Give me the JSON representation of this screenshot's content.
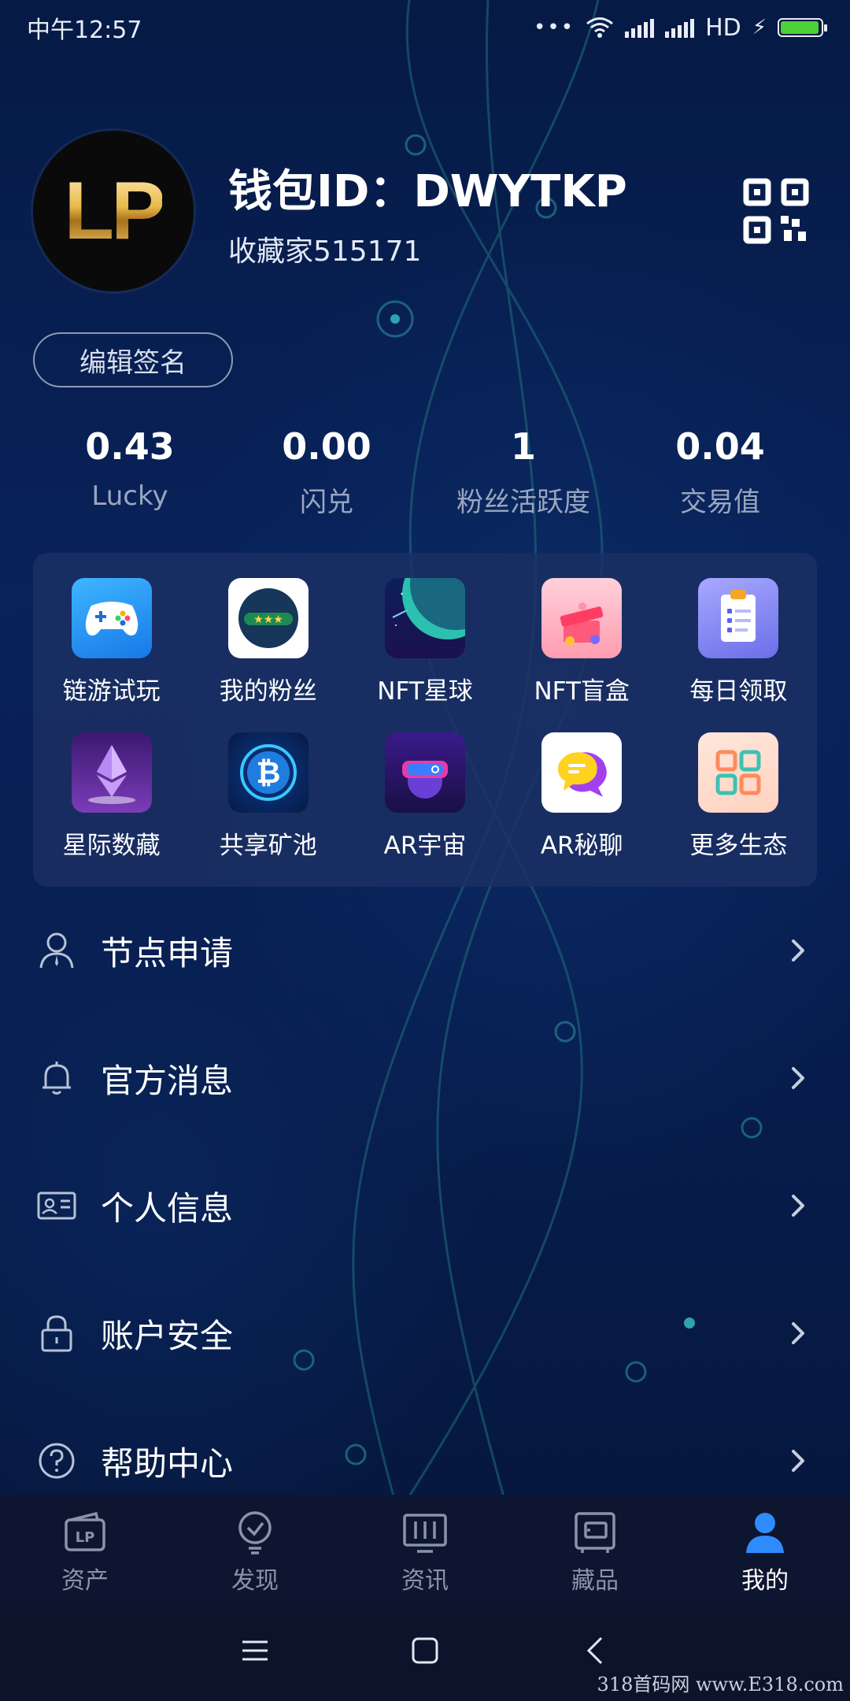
{
  "status_bar": {
    "time": "中午12:57",
    "dots": "•••",
    "network": "HD",
    "battery_level": 0.95
  },
  "profile": {
    "avatar_text": "LP",
    "wallet_id": "钱包ID：DWYTKP",
    "collector": "收藏家515171",
    "edit_signature": "编辑签名",
    "qr_icon": "qr-code-icon"
  },
  "stats": [
    {
      "value": "0.43",
      "label": "Lucky"
    },
    {
      "value": "0.00",
      "label": "闪兑"
    },
    {
      "value": "1",
      "label": "粉丝活跃度"
    },
    {
      "value": "0.04",
      "label": "交易值"
    }
  ],
  "grid": [
    {
      "label": "链游试玩",
      "icon": "gamepad-icon"
    },
    {
      "label": "我的粉丝",
      "icon": "fans-rating-icon"
    },
    {
      "label": "NFT星球",
      "icon": "planet-icon"
    },
    {
      "label": "NFT盲盒",
      "icon": "gift-box-icon"
    },
    {
      "label": "每日领取",
      "icon": "clipboard-icon"
    },
    {
      "label": "星际数藏",
      "icon": "ethereum-crystal-icon"
    },
    {
      "label": "共享矿池",
      "icon": "bitcoin-icon"
    },
    {
      "label": "AR宇宙",
      "icon": "vr-headset-icon"
    },
    {
      "label": "AR秘聊",
      "icon": "chat-bubbles-icon"
    },
    {
      "label": "更多生态",
      "icon": "apps-grid-icon"
    }
  ],
  "menu": [
    {
      "label": "节点申请",
      "icon": "user-icon"
    },
    {
      "label": "官方消息",
      "icon": "bell-icon"
    },
    {
      "label": "个人信息",
      "icon": "id-card-icon"
    },
    {
      "label": "账户安全",
      "icon": "lock-icon"
    },
    {
      "label": "帮助中心",
      "icon": "help-icon"
    }
  ],
  "bottom_nav": [
    {
      "label": "资产",
      "icon": "wallet-icon",
      "active": false
    },
    {
      "label": "发现",
      "icon": "discover-icon",
      "active": false
    },
    {
      "label": "资讯",
      "icon": "news-icon",
      "active": false
    },
    {
      "label": "藏品",
      "icon": "collection-icon",
      "active": false
    },
    {
      "label": "我的",
      "icon": "profile-icon",
      "active": true
    }
  ],
  "watermark": "318首码网 www.E318.com",
  "colors": {
    "background": "#061a45",
    "card": "#1c3063",
    "accent_blue": "#2f8cff",
    "battery_green": "#4cd137",
    "muted_text": "#9aa6bf"
  }
}
